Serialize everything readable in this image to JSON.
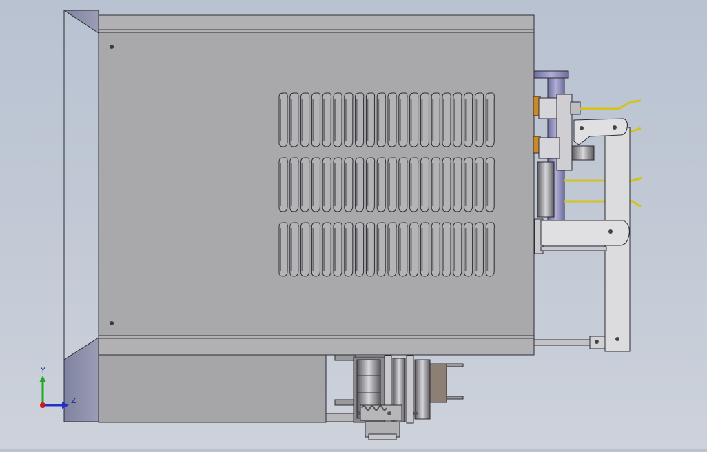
{
  "viewport": {
    "background_top": "#b8c2d1",
    "background_bottom": "#cdd2db",
    "body_color": "#a8a8aa",
    "flange_color": "#8c8fa8",
    "bracket_color": "#d8d8dc",
    "wire_color": "#d4c21a",
    "accent_orange": "#c88a2a",
    "cylinder_color": "#8e8cb8"
  },
  "louvers": {
    "rows": 3,
    "columns": 20
  },
  "triad": {
    "y_label": "Y",
    "z_label": "Z",
    "y_color": "#1faa1f",
    "z_color": "#2030c8",
    "origin_color": "#d01818"
  }
}
